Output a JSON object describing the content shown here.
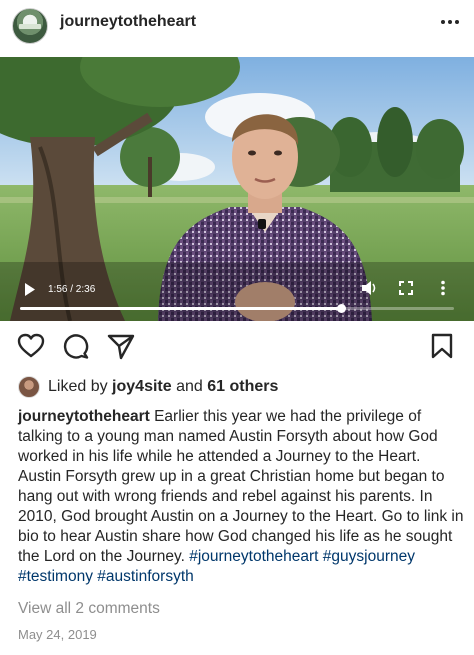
{
  "post": {
    "username": "journeytotheheart",
    "more_icon": "more-horizontal-icon",
    "video": {
      "time": "1:56 / 2:36",
      "progress": 0.74
    },
    "actions": {
      "like_icon": "heart-icon",
      "comment_icon": "comment-icon",
      "share_icon": "send-icon",
      "save_icon": "bookmark-icon"
    },
    "likes": {
      "prefix": "Liked by",
      "user": "joy4site",
      "conjunction": "and",
      "others": "61 others"
    },
    "caption": {
      "username": "journeytotheheart",
      "text": "Earlier this year we had the privilege of talking to a young man named Austin Forsyth about how God worked in his life while he attended a Journey to the Heart. Austin Forsyth grew up in a great Christian home but began to hang out with wrong friends and rebel against his parents. In 2010, God brought Austin on a Journey to the Heart. Go to link in bio to hear Austin share how God changed his life as he sought the Lord on the Journey.",
      "hashtags": "#journeytotheheart #guysjourney #testimony #austinforsyth"
    },
    "view_comments": "View all 2 comments",
    "date": "May 24, 2019"
  }
}
